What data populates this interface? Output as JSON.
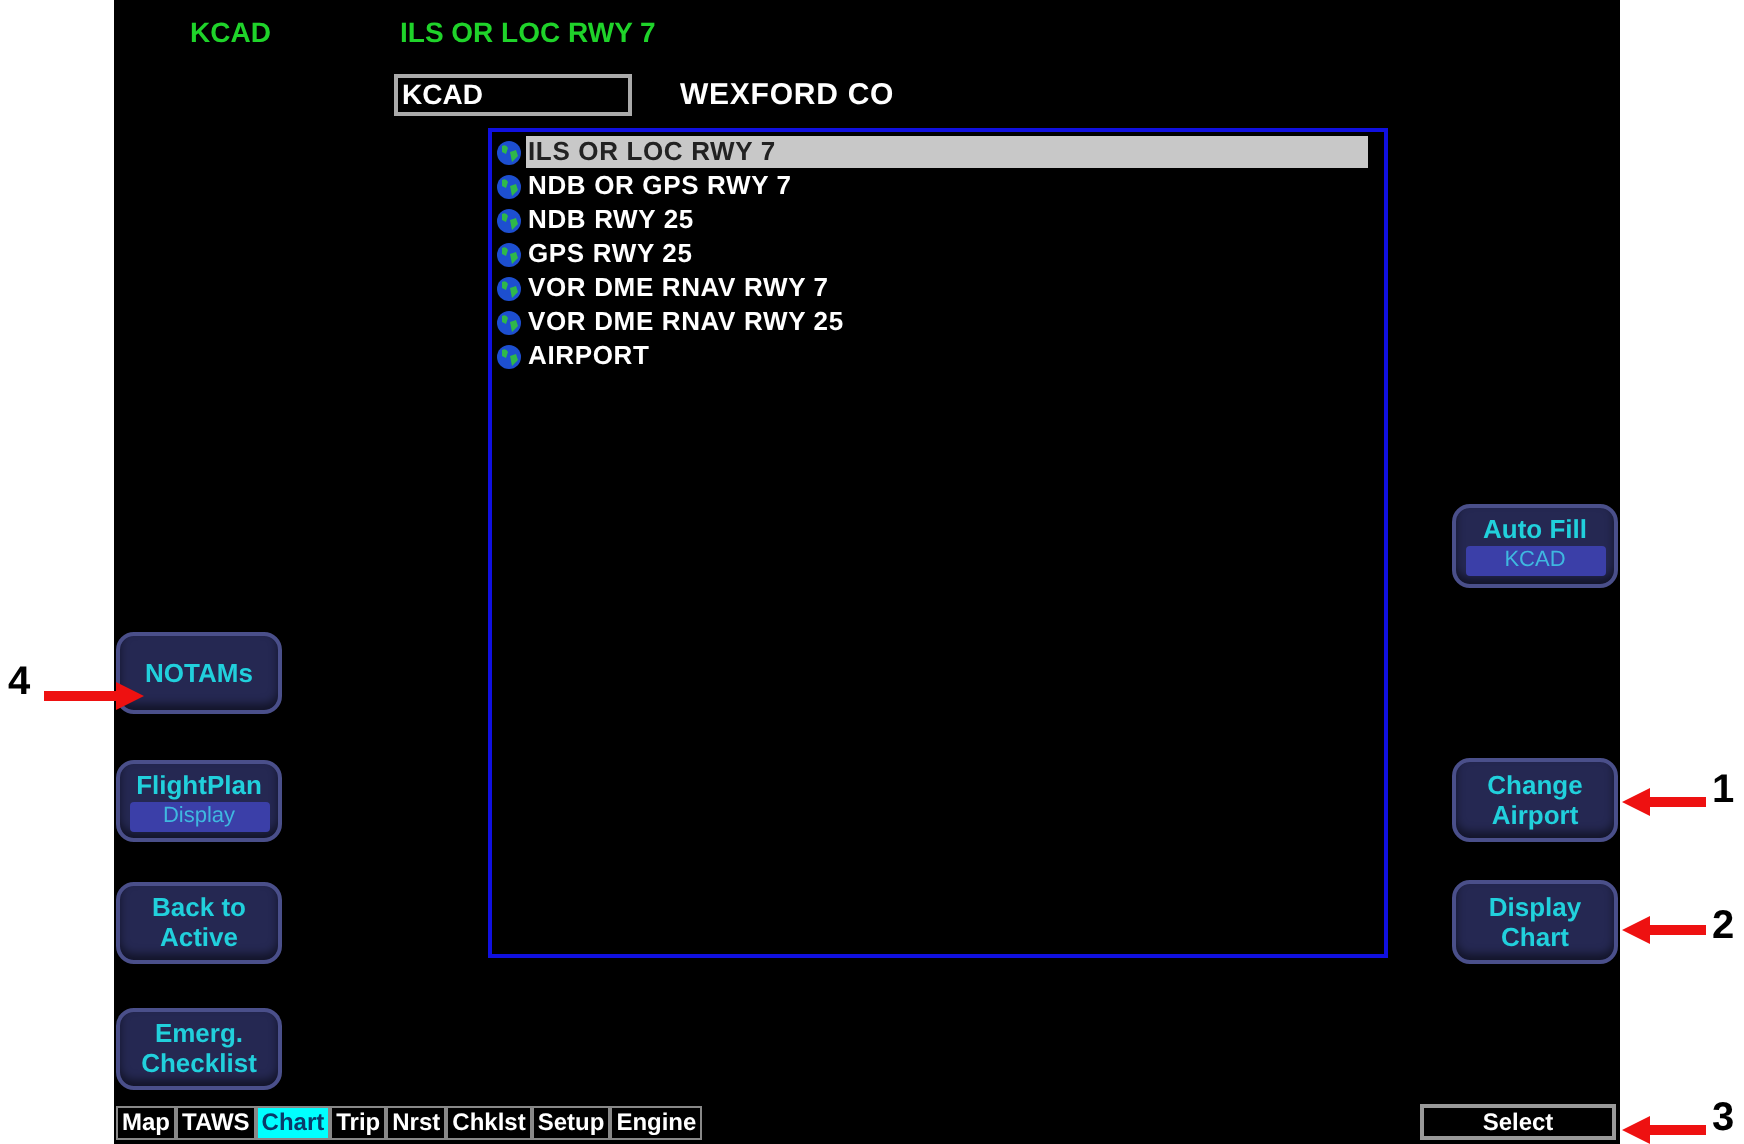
{
  "header": {
    "airport": "KCAD",
    "procedure": "ILS OR LOC RWY 7"
  },
  "airport_field": {
    "value": "KCAD"
  },
  "airport_name": "WEXFORD CO",
  "procedures": [
    {
      "label": "ILS OR LOC RWY 7",
      "selected": true
    },
    {
      "label": "NDB OR GPS RWY 7",
      "selected": false
    },
    {
      "label": "NDB RWY 25",
      "selected": false
    },
    {
      "label": "GPS RWY 25",
      "selected": false
    },
    {
      "label": "VOR DME RNAV RWY 7",
      "selected": false
    },
    {
      "label": "VOR DME RNAV RWY 25",
      "selected": false
    },
    {
      "label": "AIRPORT",
      "selected": false
    }
  ],
  "left_buttons": [
    {
      "lines": [
        "NOTAMs"
      ]
    },
    {
      "lines": [
        "FlightPlan"
      ],
      "sublabel": "Display"
    },
    {
      "lines": [
        "Back to",
        "Active"
      ]
    },
    {
      "lines": [
        "Emerg.",
        "Checklist"
      ]
    }
  ],
  "right_buttons": [
    {
      "lines": [
        "Auto Fill"
      ],
      "sublabel": "KCAD"
    },
    {
      "lines": [
        "Change",
        "Airport"
      ]
    },
    {
      "lines": [
        "Display",
        "Chart"
      ]
    }
  ],
  "tabs": [
    {
      "label": "Map",
      "selected": false
    },
    {
      "label": "TAWS",
      "selected": false
    },
    {
      "label": "Chart",
      "selected": true
    },
    {
      "label": "Trip",
      "selected": false
    },
    {
      "label": "Nrst",
      "selected": false
    },
    {
      "label": "Chklst",
      "selected": false
    },
    {
      "label": "Setup",
      "selected": false
    },
    {
      "label": "Engine",
      "selected": false
    }
  ],
  "softkey": "Select",
  "callouts": [
    {
      "label": "1"
    },
    {
      "label": "2"
    },
    {
      "label": "3"
    },
    {
      "label": "4"
    }
  ]
}
